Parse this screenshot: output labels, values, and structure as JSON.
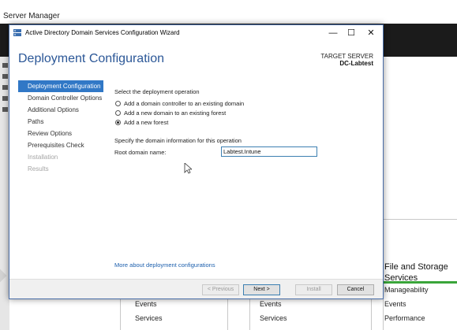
{
  "server_manager": {
    "title": "Server Manager",
    "tile": {
      "title_line1": "File and Storage",
      "title_line2": "Services",
      "rows": [
        "Manageability",
        "Events",
        "Performance"
      ]
    },
    "col1_rows": [
      "Events",
      "Services"
    ],
    "col2_rows": [
      "Events",
      "Services"
    ]
  },
  "wizard": {
    "title": "Active Directory Domain Services Configuration Wizard",
    "window_controls": {
      "minimize": "—",
      "maximize": "☐",
      "close": "✕"
    },
    "heading": "Deployment Configuration",
    "target_server_label": "TARGET SERVER",
    "target_server_value": "DC-Labtest",
    "steps": [
      {
        "label": "Deployment Configuration",
        "state": "active"
      },
      {
        "label": "Domain Controller Options",
        "state": "enabled"
      },
      {
        "label": "Additional Options",
        "state": "enabled"
      },
      {
        "label": "Paths",
        "state": "enabled"
      },
      {
        "label": "Review Options",
        "state": "enabled"
      },
      {
        "label": "Prerequisites Check",
        "state": "enabled"
      },
      {
        "label": "Installation",
        "state": "disabled"
      },
      {
        "label": "Results",
        "state": "disabled"
      }
    ],
    "operation_prompt": "Select the deployment operation",
    "operations": [
      {
        "label": "Add a domain controller to an existing domain",
        "checked": false
      },
      {
        "label": "Add a new domain to an existing forest",
        "checked": false
      },
      {
        "label": "Add a new forest",
        "checked": true
      }
    ],
    "domain_prompt": "Specify the domain information for this operation",
    "root_domain_label": "Root domain name:",
    "root_domain_value": "Labtest.Intune",
    "more_link": "More about deployment configurations",
    "buttons": {
      "previous": "< Previous",
      "next": "Next >",
      "install": "Install",
      "cancel": "Cancel"
    },
    "colors": {
      "accent": "#3178c6",
      "heading": "#2b5797",
      "link": "#1c5fad"
    }
  }
}
